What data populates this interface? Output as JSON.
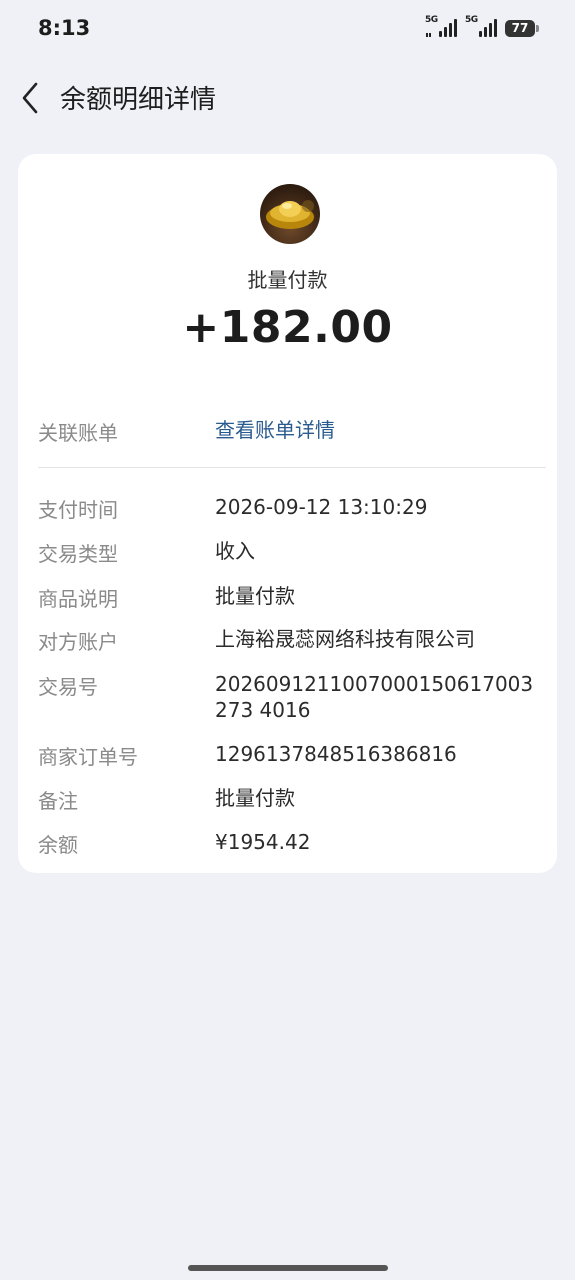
{
  "status": {
    "time": "8:13",
    "net1": "5G",
    "net2": "5G",
    "battery": "77"
  },
  "header": {
    "title": "余额明细详情"
  },
  "summary": {
    "merchant": "批量付款",
    "amount": "+182.00"
  },
  "related": {
    "label": "关联账单",
    "link": "查看账单详情"
  },
  "details": {
    "pay_time_label": "支付时间",
    "pay_time": "2026-09-12 13:10:29",
    "type_label": "交易类型",
    "type": "收入",
    "desc_label": "商品说明",
    "desc": "批量付款",
    "counterparty_label": "对方账户",
    "counterparty": "上海裕晟蕊网络科技有限公司",
    "txn_label": "交易号",
    "txn": "2026091211007000150617003273 4016",
    "order_label": "商家订单号",
    "order": "1296137848516386816",
    "remark_label": "备注",
    "remark": "批量付款",
    "balance_label": "余额",
    "balance": "¥1954.42"
  },
  "colors": {
    "background": "#eff1f6",
    "link": "#2a5b8f",
    "label": "#8a8a8a"
  },
  "icons": [
    "back-arrow-icon",
    "gold-ingot-avatar",
    "signal-icon",
    "battery-icon"
  ]
}
